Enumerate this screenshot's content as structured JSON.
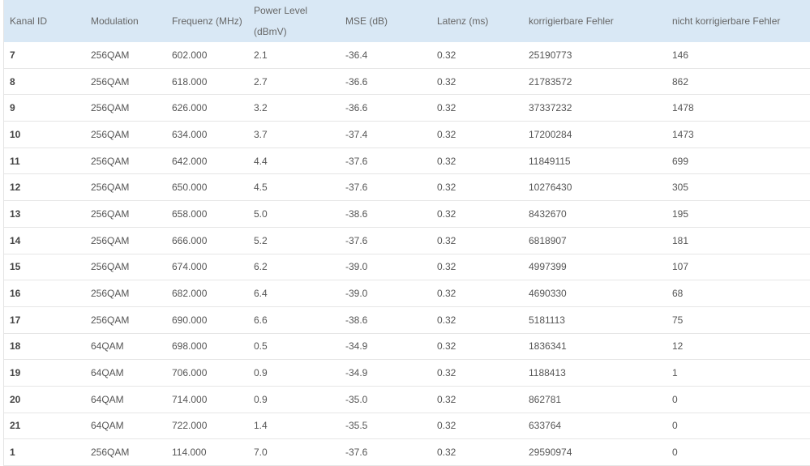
{
  "table": {
    "headers": [
      "Kanal ID",
      "Modulation",
      "Frequenz (MHz)",
      "Power Level (dBmV)",
      "MSE (dB)",
      "Latenz (ms)",
      "korrigierbare Fehler",
      "nicht korrigierbare Fehler"
    ],
    "header_power_line1": "Power Level",
    "header_power_line2": "(dBmV)",
    "rows": [
      [
        "7",
        "256QAM",
        "602.000",
        "2.1",
        "-36.4",
        "0.32",
        "25190773",
        "146"
      ],
      [
        "8",
        "256QAM",
        "618.000",
        "2.7",
        "-36.6",
        "0.32",
        "21783572",
        "862"
      ],
      [
        "9",
        "256QAM",
        "626.000",
        "3.2",
        "-36.6",
        "0.32",
        "37337232",
        "1478"
      ],
      [
        "10",
        "256QAM",
        "634.000",
        "3.7",
        "-37.4",
        "0.32",
        "17200284",
        "1473"
      ],
      [
        "11",
        "256QAM",
        "642.000",
        "4.4",
        "-37.6",
        "0.32",
        "11849115",
        "699"
      ],
      [
        "12",
        "256QAM",
        "650.000",
        "4.5",
        "-37.6",
        "0.32",
        "10276430",
        "305"
      ],
      [
        "13",
        "256QAM",
        "658.000",
        "5.0",
        "-38.6",
        "0.32",
        "8432670",
        "195"
      ],
      [
        "14",
        "256QAM",
        "666.000",
        "5.2",
        "-37.6",
        "0.32",
        "6818907",
        "181"
      ],
      [
        "15",
        "256QAM",
        "674.000",
        "6.2",
        "-39.0",
        "0.32",
        "4997399",
        "107"
      ],
      [
        "16",
        "256QAM",
        "682.000",
        "6.4",
        "-39.0",
        "0.32",
        "4690330",
        "68"
      ],
      [
        "17",
        "256QAM",
        "690.000",
        "6.6",
        "-38.6",
        "0.32",
        "5181113",
        "75"
      ],
      [
        "18",
        "64QAM",
        "698.000",
        "0.5",
        "-34.9",
        "0.32",
        "1836341",
        "12"
      ],
      [
        "19",
        "64QAM",
        "706.000",
        "0.9",
        "-34.9",
        "0.32",
        "1188413",
        "1"
      ],
      [
        "20",
        "64QAM",
        "714.000",
        "0.9",
        "-35.0",
        "0.32",
        "862781",
        "0"
      ],
      [
        "21",
        "64QAM",
        "722.000",
        "1.4",
        "-35.5",
        "0.32",
        "633764",
        "0"
      ],
      [
        "1",
        "256QAM",
        "114.000",
        "7.0",
        "-37.6",
        "0.32",
        "29590974",
        "0"
      ]
    ]
  }
}
